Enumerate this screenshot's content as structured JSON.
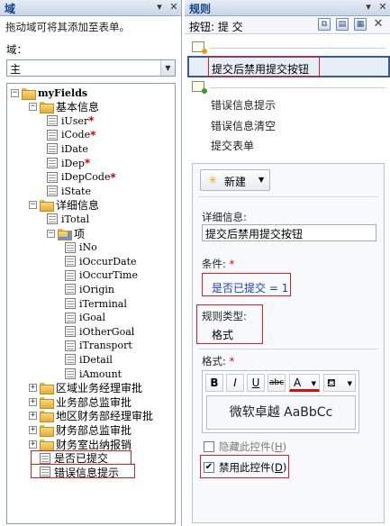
{
  "left": {
    "title": "域",
    "hint": "拖动域可将其添加至表单。",
    "field_label": "域：",
    "combo_value": "主",
    "tree": [
      {
        "label": "myFields",
        "kind": "folder",
        "level": 0,
        "exp": "-",
        "bold": true,
        "mono": true
      },
      {
        "label": "基本信息",
        "kind": "folder",
        "level": 1,
        "exp": "-"
      },
      {
        "label": "iUser",
        "kind": "field",
        "level": 2,
        "req": true,
        "mono": true
      },
      {
        "label": "iCode",
        "kind": "field",
        "level": 2,
        "req": true,
        "mono": true
      },
      {
        "label": "iDate",
        "kind": "field",
        "level": 2,
        "mono": true
      },
      {
        "label": "iDep",
        "kind": "field",
        "level": 2,
        "req": true,
        "mono": true
      },
      {
        "label": "iDepCode",
        "kind": "field",
        "level": 2,
        "req": true,
        "mono": true
      },
      {
        "label": "iState",
        "kind": "field",
        "level": 2,
        "mono": true
      },
      {
        "label": "详细信息",
        "kind": "folder",
        "level": 1,
        "exp": "-"
      },
      {
        "label": "iTotal",
        "kind": "field",
        "level": 2,
        "mono": true
      },
      {
        "label": "项",
        "kind": "repfolder",
        "level": 2,
        "exp": "-"
      },
      {
        "label": "iNo",
        "kind": "field",
        "level": 3,
        "mono": true
      },
      {
        "label": "iOccurDate",
        "kind": "field",
        "level": 3,
        "mono": true
      },
      {
        "label": "iOccurTime",
        "kind": "field",
        "level": 3,
        "mono": true
      },
      {
        "label": "iOrigin",
        "kind": "field",
        "level": 3,
        "mono": true
      },
      {
        "label": "iTerminal",
        "kind": "field",
        "level": 3,
        "mono": true
      },
      {
        "label": "iGoal",
        "kind": "field",
        "level": 3,
        "mono": true
      },
      {
        "label": "iOtherGoal",
        "kind": "field",
        "level": 3,
        "mono": true
      },
      {
        "label": "iTransport",
        "kind": "field",
        "level": 3,
        "mono": true
      },
      {
        "label": "iDetail",
        "kind": "field",
        "level": 3,
        "mono": true
      },
      {
        "label": "iAmount",
        "kind": "field",
        "level": 3,
        "mono": true
      },
      {
        "label": "区域业务经理审批",
        "kind": "folder",
        "level": 1,
        "exp": "+"
      },
      {
        "label": "业务部总监审批",
        "kind": "folder",
        "level": 1,
        "exp": "+"
      },
      {
        "label": "地区财务部经理审批",
        "kind": "folder",
        "level": 1,
        "exp": "+"
      },
      {
        "label": "财务部总监审批",
        "kind": "folder",
        "level": 1,
        "exp": "+"
      },
      {
        "label": "财务室出纳报销",
        "kind": "folder",
        "level": 1,
        "exp": "+"
      },
      {
        "label": "是否已提交",
        "kind": "field",
        "level": 1
      },
      {
        "label": "错误信息提示",
        "kind": "field",
        "level": 1
      }
    ]
  },
  "right": {
    "title": "规则",
    "button_label": "按钮: 提 交",
    "rule_name": "提交后禁用提交按钮",
    "actions": [
      "错误信息提示",
      "错误信息清空",
      "提交表单"
    ],
    "new_label": "新建",
    "details_label": "详细信息:",
    "details_value": "提交后禁用提交按钮",
    "condition_label": "条件:",
    "condition_value": "是否已提交 = 1",
    "rule_type_label": "规则类型:",
    "rule_type_value": "格式",
    "format_label": "格式:",
    "fmt_bold": "B",
    "fmt_italic": "I",
    "fmt_underline": "U",
    "fmt_strike": "abc",
    "fmt_font_color": "A",
    "preview_text": "微软卓越  AaBbCc",
    "hide_control_label": "隐藏此控件",
    "hide_control_key": "H",
    "disable_control_label": "禁用此控件",
    "disable_control_key": "D",
    "disable_checked": true,
    "required_mark": "*"
  }
}
